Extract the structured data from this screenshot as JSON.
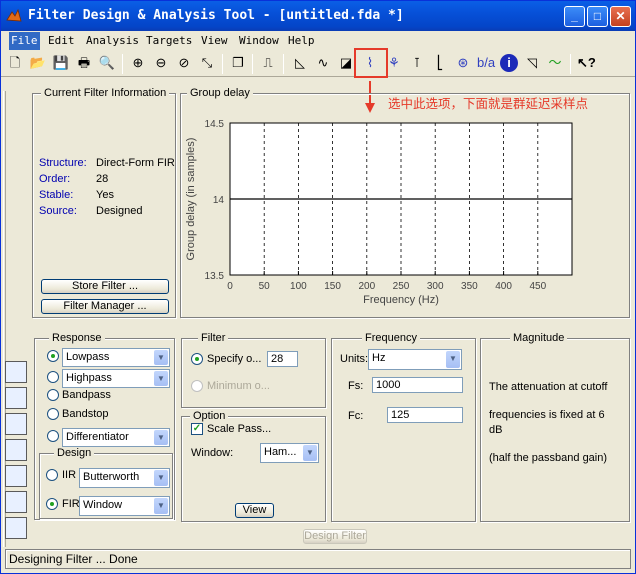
{
  "window": {
    "title": "Filter Design & Analysis Tool -  [untitled.fda *]",
    "minimize": "_",
    "maximize": "□",
    "close": "✕"
  },
  "menu": [
    "File",
    "Edit",
    "Analysis",
    "Targets",
    "View",
    "Window",
    "Help"
  ],
  "annotation": "选中此选项，下面就是群延迟采样点",
  "current_filter": {
    "title": "Current Filter Information",
    "rows": [
      {
        "label": "Structure:",
        "value": "Direct-Form FIR"
      },
      {
        "label": "Order:",
        "value": "28"
      },
      {
        "label": "Stable:",
        "value": "Yes"
      },
      {
        "label": "Source:",
        "value": "Designed"
      }
    ],
    "store_button": "Store Filter ...",
    "manager_button": "Filter Manager ..."
  },
  "plot_panel": {
    "title": "Group delay"
  },
  "chart_data": {
    "type": "line",
    "title": "",
    "xlabel": "Frequency (Hz)",
    "ylabel": "Group delay (in samples)",
    "xlim": [
      0,
      500
    ],
    "ylim": [
      13.5,
      14.5
    ],
    "x_ticks": [
      "0",
      "50",
      "100",
      "150",
      "200",
      "250",
      "300",
      "350",
      "400",
      "450"
    ],
    "y_ticks": [
      "13.5",
      "14",
      "14.5"
    ],
    "vertical_grid": true,
    "series": [
      {
        "x": [
          0,
          500
        ],
        "y": [
          14,
          14
        ]
      }
    ]
  },
  "response": {
    "title": "Response",
    "lowpass": "Lowpass",
    "highpass": "Highpass",
    "bandpass": "Bandpass",
    "bandstop": "Bandstop",
    "differentiator": "Differentiator"
  },
  "design": {
    "title": "Design",
    "iir_label": "IIR",
    "iir_value": "Butterworth",
    "fir_label": "FIR",
    "fir_value": "Window"
  },
  "filter_order": {
    "title": "Filter",
    "specify_label": "Specify o...",
    "specify_value": "28",
    "minimum_label": "Minimum o..."
  },
  "options": {
    "title": "Option",
    "scale_pass": "Scale Pass...",
    "window_label": "Window:",
    "window_value": "Ham...",
    "view_button": "View"
  },
  "frequency": {
    "title": "Frequency",
    "units_label": "Units:",
    "units_value": "Hz",
    "fs_label": "Fs:",
    "fs_value": "1000",
    "fc_label": "Fc:",
    "fc_value": "125"
  },
  "magnitude": {
    "title": "Magnitude",
    "line1": "The attenuation at cutoff",
    "line2": "frequencies is fixed at 6",
    "line3": "dB",
    "line4": "(half the passband gain)"
  },
  "design_button": "Design Filter",
  "status": "Designing Filter ... Done",
  "colors": {
    "title_bar": "#0a5fe6",
    "face": "#ece9d8",
    "annotation": "#e53a2a",
    "info_label": "#0000b0"
  }
}
